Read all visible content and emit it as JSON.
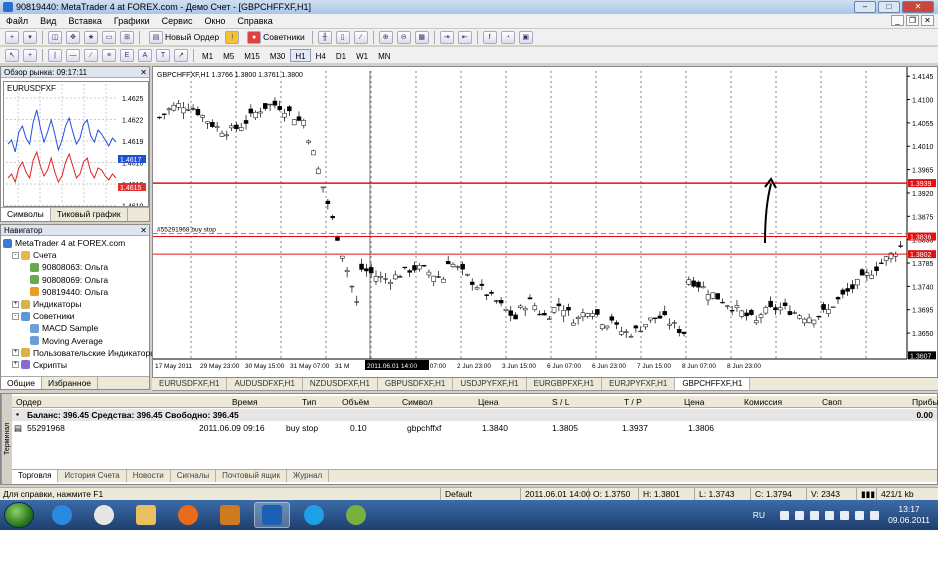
{
  "window": {
    "title": "90819440: MetaTrader 4 at FOREX.com - Демо Счет - [GBPCHFFXF,H1]"
  },
  "menu": [
    "Файл",
    "Вид",
    "Вставка",
    "Графики",
    "Сервис",
    "Окно",
    "Справка"
  ],
  "toolbar": {
    "new_order": "Новый Ордер",
    "experts": "Советники",
    "timeframes": [
      "M1",
      "M5",
      "M15",
      "M30",
      "H1",
      "H4",
      "D1",
      "W1",
      "MN"
    ],
    "active_tf": "H1"
  },
  "market_watch": {
    "title": "Обзор рынка: 09:17:11",
    "symbol": "EURUSDFXF",
    "ticks": [
      "1.4625",
      "1.4622",
      "1.4619",
      "1.4616",
      "1.4613",
      "1.4610"
    ],
    "bid": "1.4617",
    "ask": "1.4615",
    "tabs": [
      "Символы",
      "Тиковый график"
    ]
  },
  "navigator": {
    "title": "Навигатор",
    "items": [
      {
        "label": "MetaTrader 4 at FOREX.com",
        "level": 0,
        "icon": "terminal-icon",
        "color": "#3a7ad8"
      },
      {
        "label": "Счета",
        "level": 1,
        "icon": "accounts-icon",
        "color": "#e8b64a",
        "pm": "-"
      },
      {
        "label": "90808063: Ольга",
        "level": 2,
        "icon": "account-icon",
        "color": "#6aa84f"
      },
      {
        "label": "90808069: Ольга",
        "level": 2,
        "icon": "account-icon",
        "color": "#6aa84f"
      },
      {
        "label": "90819440: Ольга",
        "level": 2,
        "icon": "account-icon",
        "color": "#e6a020"
      },
      {
        "label": "Индикаторы",
        "level": 1,
        "icon": "indicators-icon",
        "color": "#d7b44a",
        "pm": "+"
      },
      {
        "label": "Советники",
        "level": 1,
        "icon": "experts-icon",
        "color": "#5a9ad6",
        "pm": "-"
      },
      {
        "label": "MACD Sample",
        "level": 2,
        "icon": "expert-icon",
        "color": "#6c9fd8"
      },
      {
        "label": "Moving Average",
        "level": 2,
        "icon": "expert-icon",
        "color": "#6c9fd8"
      },
      {
        "label": "Пользовательские Индикаторы",
        "level": 1,
        "icon": "custom-indicators-icon",
        "color": "#d7b44a",
        "pm": "+"
      },
      {
        "label": "Скрипты",
        "level": 1,
        "icon": "scripts-icon",
        "color": "#8a6ad0",
        "pm": "+"
      }
    ],
    "tabs": [
      "Общие",
      "Избранное"
    ]
  },
  "chart": {
    "header": "GBPCHFFXF,H1  1.3766 1.3800 1.3761 1.3800",
    "order_label": "#55291968 buy stop",
    "price_ticks": [
      "1.4145",
      "1.4100",
      "1.4055",
      "1.4010",
      "1.3965",
      "1.3920",
      "1.3875",
      "1.3830",
      "1.3785",
      "1.3740",
      "1.3695",
      "1.3650"
    ],
    "levels": [
      {
        "label": "1.3939",
        "value": 1.3939,
        "color": "#e01010"
      },
      {
        "label": "1.3836",
        "value": 1.3836,
        "color": "#e01010"
      },
      {
        "label": "1.3802",
        "value": 1.3802,
        "color": "#e01010"
      },
      {
        "label": "1.3607",
        "value": 1.3607,
        "color": "#000000"
      }
    ],
    "time_labels": [
      "17 May 2011",
      "29 May 23:00",
      "30 May 15:00",
      "31 May 07:00",
      "31 M",
      "2011.06.01 14:00",
      "2 Jun 07:00",
      "2 Jun 23:00",
      "3 Jun 15:00",
      "6 Jun 07:00",
      "6 Jun 23:00",
      "7 Jun 15:00",
      "8 Jun 07:00",
      "8 Jun 23:00"
    ],
    "cursor_time": "2011.06.01 14:00"
  },
  "chart_tabs": [
    "EURUSDFXF,H1",
    "AUDUSDFXF,H1",
    "NZDUSDFXF,H1",
    "GBPUSDFXF,H1",
    "USDJPYFXF,H1",
    "EURGBPFXF,H1",
    "EURJPYFXF,H1",
    "GBPCHFFXF,H1"
  ],
  "terminal": {
    "side": "Терминал",
    "columns": [
      "Ордер",
      "Время",
      "Тип",
      "Объём",
      "Символ",
      "Цена",
      "S / L",
      "T / P",
      "Цена",
      "Комиссия",
      "Своп",
      "Прибыль"
    ],
    "balance": "Баланс: 396.45  Средства: 396.45  Свободно: 396.45",
    "balance_profit": "0.00",
    "order": {
      "id": "55291968",
      "time": "2011.06.09 09:16",
      "type": "buy stop",
      "volume": "0.10",
      "symbol": "gbpchffxf",
      "price": "1.3840",
      "sl": "1.3805",
      "tp": "1.3937",
      "cur": "1.3806"
    },
    "tabs": [
      "Торговля",
      "История Счета",
      "Новости",
      "Сигналы",
      "Почтовый ящик",
      "Журнал"
    ]
  },
  "status": {
    "help": "Для справки, нажмите F1",
    "profile": "Default",
    "time": "2011.06.01 14:00",
    "o": "O: 1.3750",
    "h": "H: 1.3801",
    "l": "L: 1.3743",
    "c": "C: 1.3794",
    "v": "V: 2343",
    "traffic": "421/1 kb"
  },
  "taskbar": {
    "lang": "RU",
    "time": "13:17",
    "date": "09.06.2011"
  }
}
